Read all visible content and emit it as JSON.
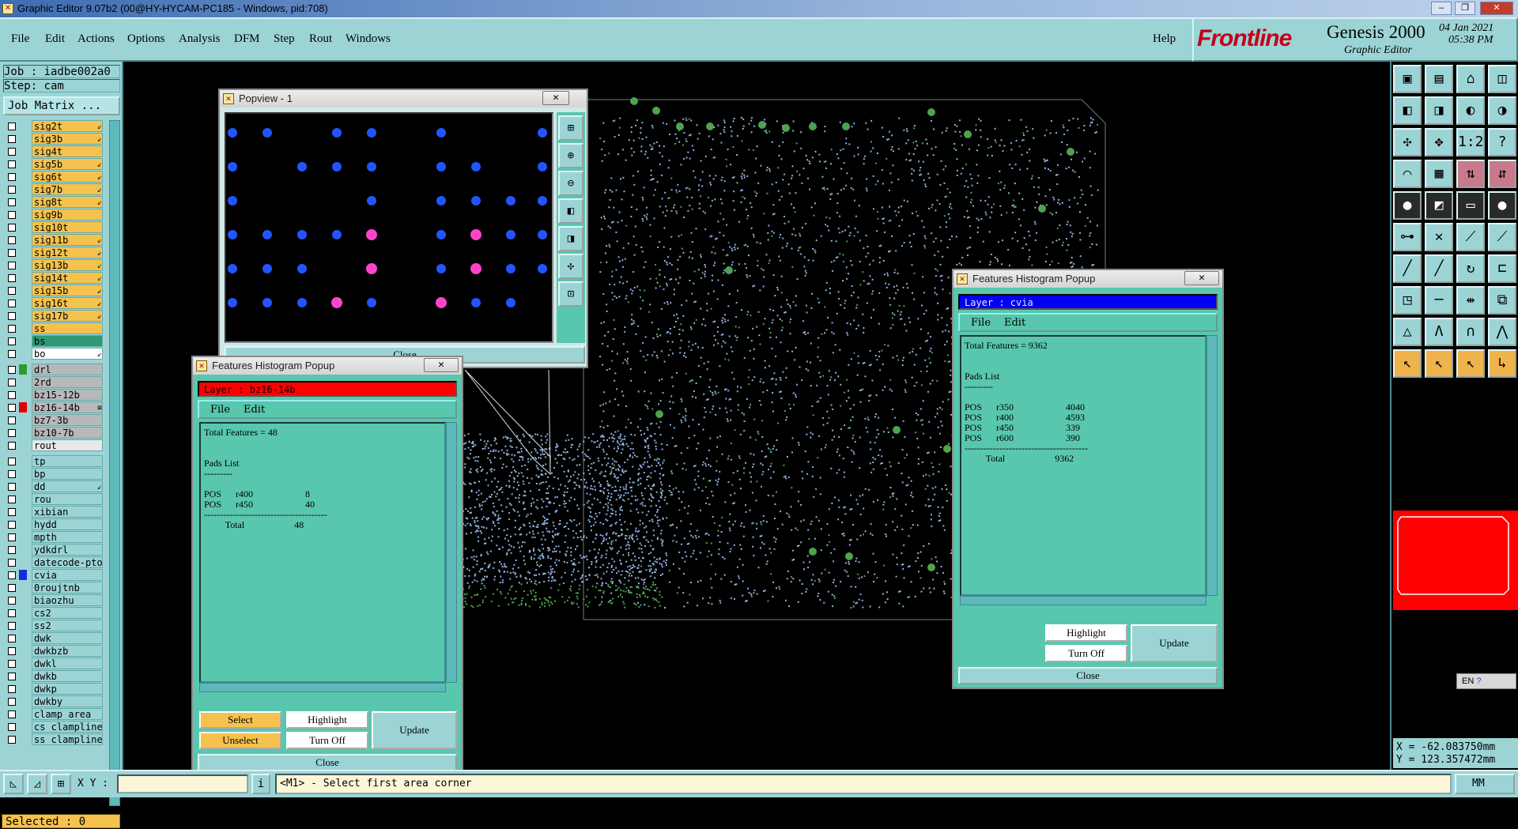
{
  "window": {
    "title": "Graphic Editor 9.07b2 (00@HY-HYCAM-PC185 - Windows, pid:708)",
    "min": "–",
    "max": "❐",
    "close": "✕"
  },
  "menu": [
    "File",
    "Edit",
    "Actions",
    "Options",
    "Analysis",
    "DFM",
    "Step",
    "Rout",
    "Windows"
  ],
  "help": "Help",
  "brand": {
    "logo": "Frontline",
    "product": "Genesis 2000",
    "subtitle": "Graphic Editor",
    "date": "04 Jan 2021",
    "time": "05:38 PM"
  },
  "job": {
    "job_label": "Job : iadbe002a0",
    "step_label": "Step: cam",
    "matrix_button": "Job Matrix ..."
  },
  "layers": [
    {
      "name": "sig2t",
      "bg": "#f5c24e",
      "swatch": "",
      "arrow": "⇙"
    },
    {
      "name": "sig3b",
      "bg": "#f5c24e",
      "swatch": "",
      "arrow": "⇙"
    },
    {
      "name": "sig4t",
      "bg": "#f5c24e",
      "swatch": "",
      "arrow": ""
    },
    {
      "name": "sig5b",
      "bg": "#f5c24e",
      "swatch": "",
      "arrow": "⇙"
    },
    {
      "name": "sig6t",
      "bg": "#f5c24e",
      "swatch": "",
      "arrow": "⇙"
    },
    {
      "name": "sig7b",
      "bg": "#f5c24e",
      "swatch": "",
      "arrow": "⇙"
    },
    {
      "name": "sig8t",
      "bg": "#f5c24e",
      "swatch": "",
      "arrow": "⇙"
    },
    {
      "name": "sig9b",
      "bg": "#f5c24e",
      "swatch": "",
      "arrow": ""
    },
    {
      "name": "sig10t",
      "bg": "#f5c24e",
      "swatch": "",
      "arrow": ""
    },
    {
      "name": "sig11b",
      "bg": "#f5c24e",
      "swatch": "",
      "arrow": "⇙"
    },
    {
      "name": "sig12t",
      "bg": "#f5c24e",
      "swatch": "",
      "arrow": "⇙"
    },
    {
      "name": "sig13b",
      "bg": "#f5c24e",
      "swatch": "",
      "arrow": "⇙"
    },
    {
      "name": "sig14t",
      "bg": "#f5c24e",
      "swatch": "",
      "arrow": "⇙"
    },
    {
      "name": "sig15b",
      "bg": "#f5c24e",
      "swatch": "",
      "arrow": "⇙"
    },
    {
      "name": "sig16t",
      "bg": "#f5c24e",
      "swatch": "",
      "arrow": "⇙"
    },
    {
      "name": "sig17b",
      "bg": "#f5c24e",
      "swatch": "",
      "arrow": "⇙"
    },
    {
      "name": "ss",
      "bg": "#f5c24e",
      "swatch": "",
      "arrow": ""
    },
    {
      "name": "bs",
      "bg": "#2e9a73",
      "swatch": "",
      "arrow": ""
    },
    {
      "name": "bo",
      "bg": "#ffffff",
      "swatch": "",
      "arrow": "⇙"
    },
    {
      "name": "drl",
      "bg": "#b8b8b8",
      "swatch": "#2e9a2e",
      "arrow": ""
    },
    {
      "name": "2rd",
      "bg": "#b8b8b8",
      "swatch": "",
      "arrow": ""
    },
    {
      "name": "bz15-12b",
      "bg": "#b8b8b8",
      "swatch": "",
      "arrow": ""
    },
    {
      "name": "bz16-14b",
      "bg": "#b8b8b8",
      "swatch": "#e00000",
      "arrow": "≡"
    },
    {
      "name": "bz7-3b",
      "bg": "#b8b8b8",
      "swatch": "",
      "arrow": ""
    },
    {
      "name": "bz10-7b",
      "bg": "#b8b8b8",
      "swatch": "",
      "arrow": ""
    },
    {
      "name": "rout",
      "bg": "#e8e8e8",
      "swatch": "",
      "arrow": ""
    },
    {
      "name": "tp",
      "bg": "#9cd4d6",
      "swatch": "",
      "arrow": ""
    },
    {
      "name": "bp",
      "bg": "#9cd4d6",
      "swatch": "",
      "arrow": ""
    },
    {
      "name": "dd",
      "bg": "#9cd4d6",
      "swatch": "",
      "arrow": "⇙"
    },
    {
      "name": "rou",
      "bg": "#9cd4d6",
      "swatch": "",
      "arrow": ""
    },
    {
      "name": "xibian",
      "bg": "#9cd4d6",
      "swatch": "",
      "arrow": ""
    },
    {
      "name": "hydd",
      "bg": "#9cd4d6",
      "swatch": "",
      "arrow": ""
    },
    {
      "name": "mpth",
      "bg": "#9cd4d6",
      "swatch": "",
      "arrow": ""
    },
    {
      "name": "ydkdrl",
      "bg": "#9cd4d6",
      "swatch": "",
      "arrow": ""
    },
    {
      "name": "datecode-pto",
      "bg": "#9cd4d6",
      "swatch": "",
      "arrow": ""
    },
    {
      "name": "cvia",
      "bg": "#9cd4d6",
      "swatch": "#1a2adf",
      "arrow": ""
    },
    {
      "name": "0roujtnb",
      "bg": "#9cd4d6",
      "swatch": "",
      "arrow": ""
    },
    {
      "name": "biaozhu",
      "bg": "#9cd4d6",
      "swatch": "",
      "arrow": ""
    },
    {
      "name": "cs2",
      "bg": "#9cd4d6",
      "swatch": "",
      "arrow": ""
    },
    {
      "name": "ss2",
      "bg": "#9cd4d6",
      "swatch": "",
      "arrow": ""
    },
    {
      "name": "dwk",
      "bg": "#9cd4d6",
      "swatch": "",
      "arrow": ""
    },
    {
      "name": "dwkbzb",
      "bg": "#9cd4d6",
      "swatch": "",
      "arrow": ""
    },
    {
      "name": "dwkl",
      "bg": "#9cd4d6",
      "swatch": "",
      "arrow": ""
    },
    {
      "name": "dwkb",
      "bg": "#9cd4d6",
      "swatch": "",
      "arrow": ""
    },
    {
      "name": "dwkp",
      "bg": "#9cd4d6",
      "swatch": "",
      "arrow": ""
    },
    {
      "name": "dwkby",
      "bg": "#9cd4d6",
      "swatch": "",
      "arrow": ""
    },
    {
      "name": "clamp_area",
      "bg": "#9cd4d6",
      "swatch": "",
      "arrow": ""
    },
    {
      "name": "cs_clampline",
      "bg": "#9cd4d6",
      "swatch": "",
      "arrow": ""
    },
    {
      "name": "ss_clampline",
      "bg": "#9cd4d6",
      "swatch": "",
      "arrow": ""
    }
  ],
  "selected": "Selected : 0",
  "popview": {
    "title": "Popview - 1",
    "close": "Close"
  },
  "hist_left": {
    "title": "Features Histogram Popup",
    "layer": "Layer :  bz16-14b",
    "menu": [
      "File",
      "Edit"
    ],
    "lines": [
      "Total Features = 48",
      "",
      "",
      "Pads List",
      "---------",
      "",
      "POS      r400                      8",
      "POS      r450                      40",
      "---------------------------------------",
      "         Total                     48"
    ],
    "buttons": {
      "select": "Select",
      "unselect": "Unselect",
      "highlight": "Highlight",
      "turn_off": "Turn Off",
      "update": "Update",
      "close": "Close"
    }
  },
  "hist_right": {
    "title": "Features Histogram Popup",
    "layer": "Layer :  cvia",
    "menu": [
      "File",
      "Edit"
    ],
    "lines": [
      "Total Features = 9362",
      "",
      "",
      "Pads List",
      "---------",
      "",
      "POS      r350                      4040",
      "POS      r400                      4593",
      "POS      r450                      339",
      "POS      r600                      390",
      "---------------------------------------",
      "         Total                     9362"
    ],
    "buttons": {
      "highlight": "Highlight",
      "turn_off": "Turn Off",
      "update": "Update",
      "close": "Close"
    }
  },
  "coords": {
    "x": "X = -62.083750mm",
    "y": "Y = 123.357472mm"
  },
  "status": {
    "xy_label": "X Y :",
    "prompt": "<M1> - Select first area corner",
    "units": "MM"
  },
  "lang": "EN"
}
